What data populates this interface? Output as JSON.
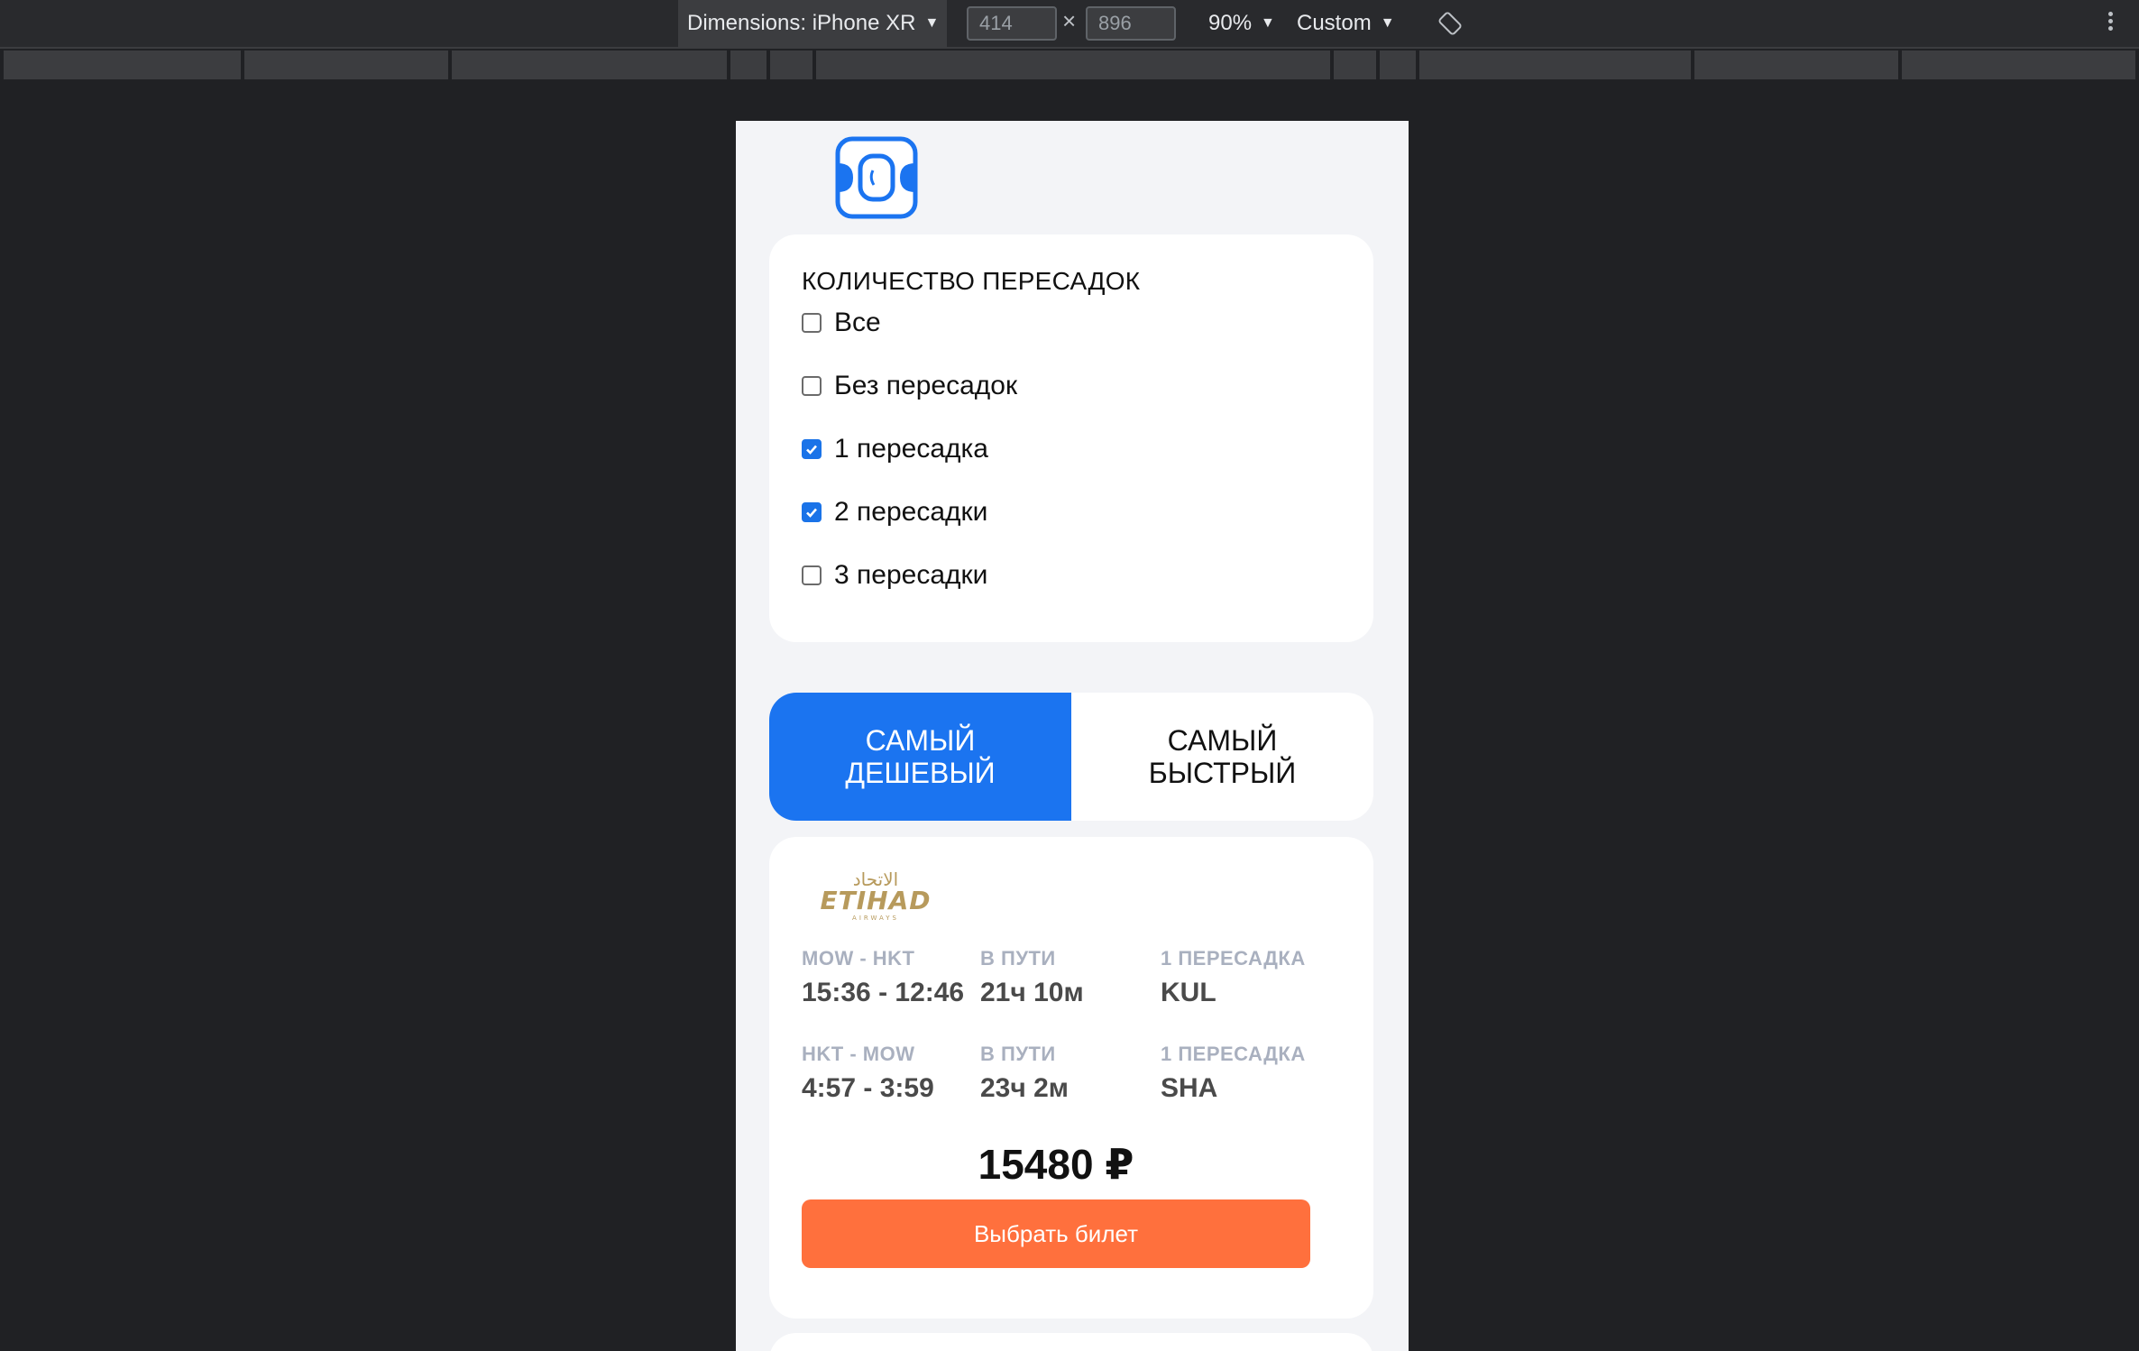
{
  "devtools": {
    "dimensions_label": "Dimensions: iPhone XR",
    "width_value": "414",
    "height_value": "896",
    "times": "×",
    "zoom": "90%",
    "throttle": "Custom"
  },
  "filters": {
    "title": "КОЛИЧЕСТВО ПЕРЕСАДОК",
    "items": [
      {
        "label": "Все",
        "checked": false
      },
      {
        "label": "Без пересадок",
        "checked": false
      },
      {
        "label": "1 пересадка",
        "checked": true
      },
      {
        "label": "2 пересадки",
        "checked": true
      },
      {
        "label": "3 пересадки",
        "checked": false
      }
    ]
  },
  "sort_tabs": [
    {
      "label": "САМЫЙ ДЕШЕВЫЙ",
      "active": true
    },
    {
      "label": "САМЫЙ БЫСТРЫЙ",
      "active": false
    }
  ],
  "ticket": {
    "airline_logo_text": "ETIHAD",
    "airline_logo_sub": "AIRWAYS",
    "airline_logo_arabic": "الاتحاد",
    "segments": [
      {
        "route": "MOW - HKT",
        "time": "15:36 - 12:46",
        "duration_label": "В ПУТИ",
        "duration": "21ч 10м",
        "stops_label": "1 ПЕРЕСАДКА",
        "stops": "KUL"
      },
      {
        "route": "HKT - MOW",
        "time": "4:57 - 3:59",
        "duration_label": "В ПУТИ",
        "duration": "23ч 2м",
        "stops_label": "1 ПЕРЕСАДКА",
        "stops": "SHA"
      }
    ],
    "price": "15480 ₽",
    "buy_label": "Выбрать билет"
  },
  "colors": {
    "accent": "#1b74f0",
    "buy": "#ff703d",
    "airline_gold": "#b79a5c"
  }
}
